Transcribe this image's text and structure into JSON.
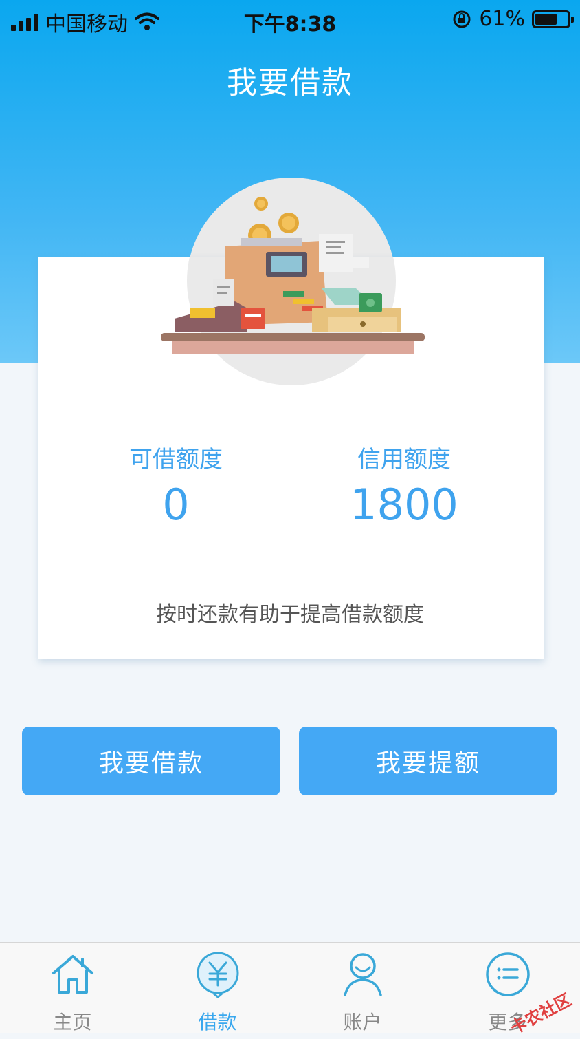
{
  "status_bar": {
    "carrier": "中国移动",
    "time": "下午8:38",
    "battery_percent": "61%",
    "battery_level": 0.61
  },
  "header": {
    "title": "我要借款"
  },
  "card": {
    "available": {
      "label": "可借额度",
      "value": "0"
    },
    "credit": {
      "label": "信用额度",
      "value": "1800"
    },
    "tip": "按时还款有助于提高借款额度"
  },
  "actions": {
    "borrow_label": "我要借款",
    "raise_label": "我要提额"
  },
  "tabbar": {
    "items": [
      {
        "label": "主页",
        "icon": "home-icon",
        "active": false
      },
      {
        "label": "借款",
        "icon": "yuan-icon",
        "active": true
      },
      {
        "label": "账户",
        "icon": "user-icon",
        "active": false
      },
      {
        "label": "更多",
        "icon": "list-icon",
        "active": false
      }
    ]
  },
  "watermark": "卡农社区",
  "colors": {
    "header_blue": "#0aa7ef",
    "accent_blue": "#3fa3ee",
    "button_blue": "#44a8f5",
    "page_bg": "#f2f6fa"
  }
}
